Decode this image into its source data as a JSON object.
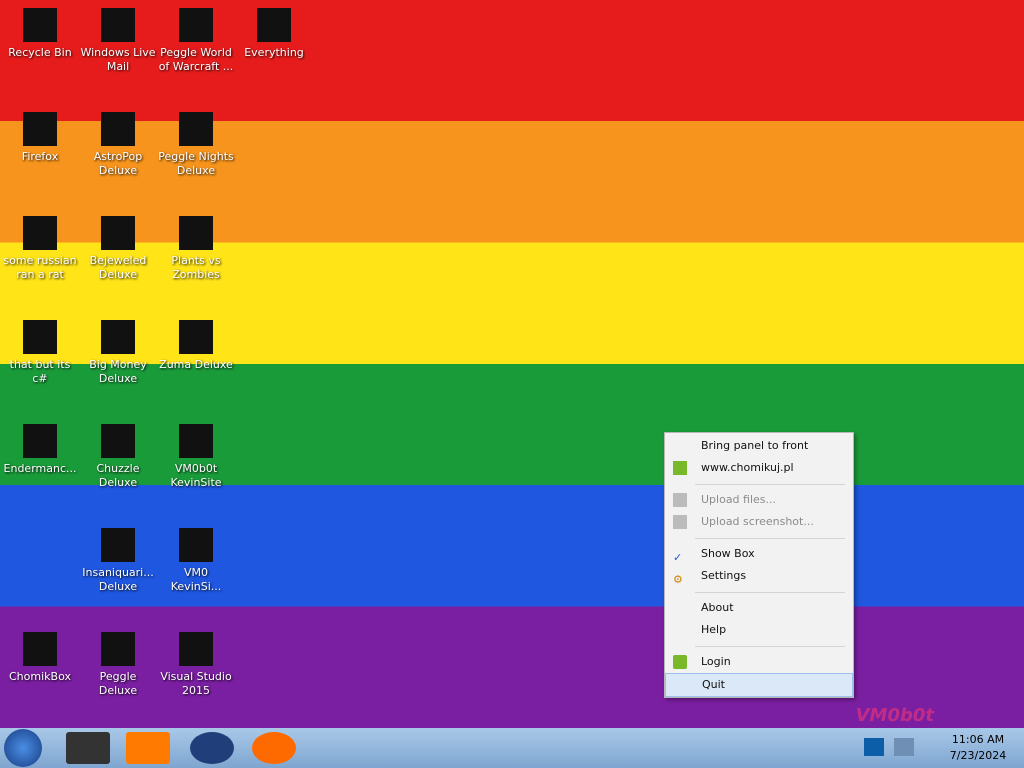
{
  "desktop": {
    "icons": [
      {
        "label": "Recycle Bin"
      },
      {
        "label": "Windows Live Mail"
      },
      {
        "label": "Peggle World of Warcraft ..."
      },
      {
        "label": "Everything"
      },
      {
        "label": "Firefox"
      },
      {
        "label": "AstroPop Deluxe"
      },
      {
        "label": "Peggle Nights Deluxe"
      },
      {
        "label": "some russian ran a rat"
      },
      {
        "label": "Bejeweled Deluxe"
      },
      {
        "label": "Plants vs Zombies"
      },
      {
        "label": "that but its c#"
      },
      {
        "label": "Big Money Deluxe"
      },
      {
        "label": "Zuma Deluxe"
      },
      {
        "label": "Endermanc..."
      },
      {
        "label": "Chuzzle Deluxe"
      },
      {
        "label": "VM0b0t KevinSite"
      },
      {
        "label": "Insaniquari... Deluxe"
      },
      {
        "label": "VM0 KevinSi..."
      },
      {
        "label": "ChomikBox"
      },
      {
        "label": "Peggle Deluxe"
      },
      {
        "label": "Visual Studio 2015"
      }
    ],
    "watermark": "VM0b0t"
  },
  "context_menu": {
    "items": [
      {
        "label": "Bring panel to front",
        "enabled": true,
        "icon": ""
      },
      {
        "label": "www.chomikuj.pl",
        "enabled": true,
        "icon": "home-icon"
      },
      {
        "label": "Upload files...",
        "enabled": false,
        "icon": "upload-icon"
      },
      {
        "label": "Upload screenshot...",
        "enabled": false,
        "icon": "camera-icon"
      },
      {
        "label": "Show Box",
        "enabled": true,
        "icon": "checkmark-icon"
      },
      {
        "label": "Settings",
        "enabled": true,
        "icon": "gear-icon"
      },
      {
        "label": "About",
        "enabled": true,
        "icon": ""
      },
      {
        "label": "Help",
        "enabled": true,
        "icon": ""
      },
      {
        "label": "Login",
        "enabled": true,
        "icon": "login-icon"
      },
      {
        "label": "Quit",
        "enabled": true,
        "icon": ""
      }
    ]
  },
  "taskbar": {
    "clock_time": "11:06 AM",
    "clock_date": "7/23/2024"
  },
  "colors": {
    "accent": "#1f57e0"
  }
}
